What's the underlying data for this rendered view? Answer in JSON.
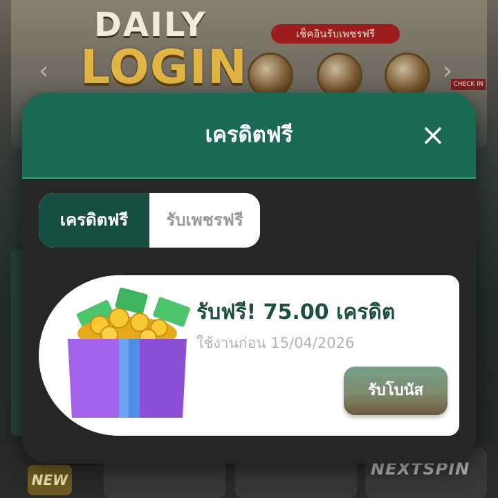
{
  "background": {
    "banner_line1": "DAILY",
    "banner_line2": "LOGIN",
    "checkin_pill": "เช็คอินรับเพชรฟรี",
    "checkin_tag": "CHECK IN",
    "new_badge": "NEW",
    "provider_label": "NEXTSPIN"
  },
  "modal": {
    "title": "เครดิตฟรี",
    "close_icon": "close-icon",
    "tabs": [
      {
        "label": "เครดิตฟรี",
        "active": true
      },
      {
        "label": "รับเพชรฟรี",
        "active": false
      }
    ],
    "bonus": {
      "title": "รับฟรี! 75.00 เครดิต",
      "expiry": "ใช้งานก่อน 15/04/2026",
      "claim_label": "รับโบนัส",
      "icon": "gift-box-icon"
    }
  },
  "colors": {
    "header_green": "#1a6a55",
    "active_tab": "#164f42",
    "title_text": "#1d4e42",
    "modal_bg": "#262626"
  }
}
